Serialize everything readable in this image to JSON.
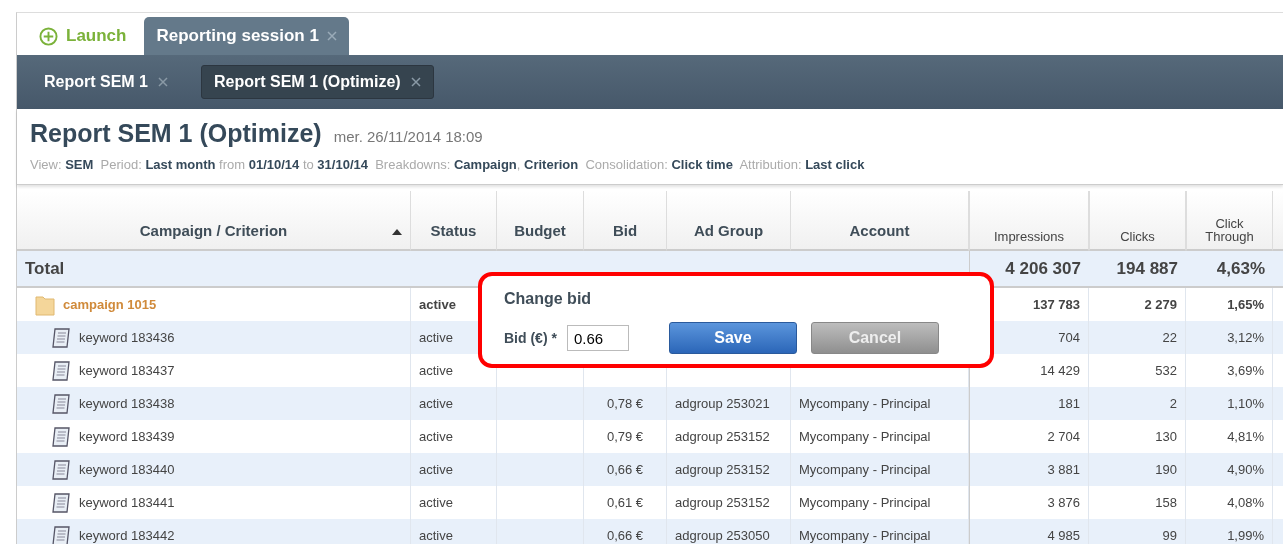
{
  "top_tabs": [
    {
      "label": "Launch",
      "kind": "launch",
      "selected": false
    },
    {
      "label": "Reporting session 1",
      "kind": "session",
      "selected": true
    }
  ],
  "report_tabs": [
    {
      "label": "Report SEM 1",
      "selected": false
    },
    {
      "label": "Report SEM 1 (Optimize)",
      "selected": true
    }
  ],
  "report": {
    "title": "Report SEM 1 (Optimize)",
    "date": "mer. 26/11/2014 18:09",
    "meta": "View: **SEM**  Period: **Last month** from **01/10/14** to **31/10/14**  Breakdowns: **Campaign**, **Criterion**  Consolidation: **Click time**  Attribution: **Last click**"
  },
  "table": {
    "columns": [
      "Campaign / Criterion",
      "Status",
      "Budget",
      "Bid",
      "Ad Group",
      "Account",
      "Impressions",
      "Clicks",
      "Click Through"
    ],
    "total": {
      "label": "Total",
      "impressions": "4 206 307",
      "clicks": "194 887",
      "ctr": "4,63%"
    },
    "rows": [
      {
        "kind": "campaign",
        "name": "campaign 1015",
        "status": "active",
        "impressions": "137 783",
        "clicks": "2 279",
        "ctr": "1,65%"
      },
      {
        "kind": "keyword",
        "name": "keyword 183436",
        "status": "active",
        "impressions": "704",
        "clicks": "22",
        "ctr": "3,12%"
      },
      {
        "kind": "keyword",
        "name": "keyword 183437",
        "status": "active",
        "impressions": "14 429",
        "clicks": "532",
        "ctr": "3,69%"
      },
      {
        "kind": "keyword",
        "name": "keyword 183438",
        "status": "active",
        "bid": "0,78 €",
        "ad_group": "adgroup 253021",
        "account": "Mycompany - Principal",
        "impressions": "181",
        "clicks": "2",
        "ctr": "1,10%"
      },
      {
        "kind": "keyword",
        "name": "keyword 183439",
        "status": "active",
        "bid": "0,79 €",
        "ad_group": "adgroup 253152",
        "account": "Mycompany - Principal",
        "impressions": "2 704",
        "clicks": "130",
        "ctr": "4,81%"
      },
      {
        "kind": "keyword",
        "name": "keyword 183440",
        "status": "active",
        "bid": "0,66 €",
        "ad_group": "adgroup 253152",
        "account": "Mycompany - Principal",
        "impressions": "3 881",
        "clicks": "190",
        "ctr": "4,90%"
      },
      {
        "kind": "keyword",
        "name": "keyword 183441",
        "status": "active",
        "bid": "0,61 €",
        "ad_group": "adgroup 253152",
        "account": "Mycompany - Principal",
        "impressions": "3 876",
        "clicks": "158",
        "ctr": "4,08%"
      },
      {
        "kind": "keyword",
        "name": "keyword 183442",
        "status": "active",
        "bid": "0,66 €",
        "ad_group": "adgroup 253050",
        "account": "Mycompany - Principal",
        "impressions": "4 985",
        "clicks": "99",
        "ctr": "1,99%"
      }
    ]
  },
  "dialog": {
    "title": "Change bid",
    "field_label": "Bid (€) *",
    "value": "0.66",
    "buttons": [
      {
        "label": "Save",
        "kind": "primary"
      },
      {
        "label": "Cancel",
        "kind": "secondary"
      }
    ]
  }
}
